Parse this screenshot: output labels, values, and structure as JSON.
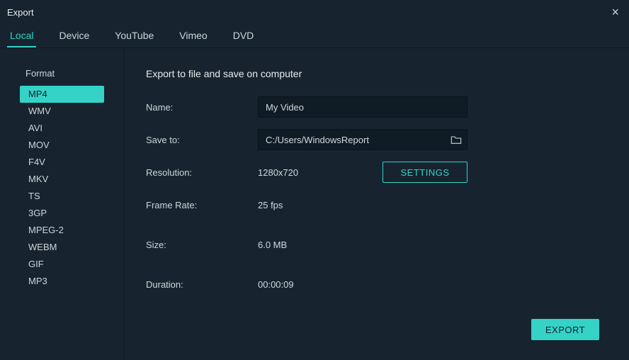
{
  "window": {
    "title": "Export"
  },
  "tabs": {
    "local": "Local",
    "device": "Device",
    "youtube": "YouTube",
    "vimeo": "Vimeo",
    "dvd": "DVD"
  },
  "sidebar": {
    "heading": "Format",
    "items": [
      {
        "label": "MP4"
      },
      {
        "label": "WMV"
      },
      {
        "label": "AVI"
      },
      {
        "label": "MOV"
      },
      {
        "label": "F4V"
      },
      {
        "label": "MKV"
      },
      {
        "label": "TS"
      },
      {
        "label": "3GP"
      },
      {
        "label": "MPEG-2"
      },
      {
        "label": "WEBM"
      },
      {
        "label": "GIF"
      },
      {
        "label": "MP3"
      }
    ]
  },
  "main": {
    "heading": "Export to file and save on computer",
    "labels": {
      "name": "Name:",
      "saveto": "Save to:",
      "resolution": "Resolution:",
      "framerate": "Frame Rate:",
      "size": "Size:",
      "duration": "Duration:"
    },
    "values": {
      "name": "My Video",
      "saveto": "C:/Users/WindowsReport",
      "resolution": "1280x720",
      "framerate": "25 fps",
      "size": "6.0 MB",
      "duration": "00:00:09"
    },
    "buttons": {
      "settings": "SETTINGS",
      "export": "EXPORT"
    }
  }
}
